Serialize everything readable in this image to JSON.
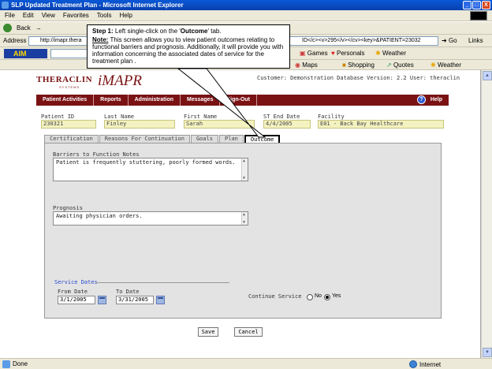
{
  "window": {
    "title": "SLP Updated Treatment Plan - Microsoft Internet Explorer",
    "controls": [
      "_",
      "□",
      "X"
    ]
  },
  "menu": [
    "File",
    "Edit",
    "View",
    "Favorites",
    "Tools",
    "Help"
  ],
  "toolbar": {
    "back_label": "Back",
    "address_label": "Address",
    "address_value": "http://imapr.thera",
    "address_tail": "ID</c><v>295</v></cv><key>&PATIENT=23032",
    "go_label": "Go",
    "links_label": "Links"
  },
  "aimbar": {
    "aim_label": "AIM",
    "games": "Games",
    "personals": "Personals",
    "weather": "Weather"
  },
  "linksbar": {
    "maps": "Maps",
    "shopping": "Shopping",
    "quotes": "Quotes",
    "weather": "Weather"
  },
  "app": {
    "brand": "THERACLIN",
    "brand_sub": "SYSTEMS",
    "product": "iMAPR",
    "customer_line": "Customer: Demonstration Database Version: 2.2 User: theraclin"
  },
  "nav": [
    "Patient Activities",
    "Reports",
    "Administration",
    "Messages",
    "Sign-Out"
  ],
  "help_label": "Help",
  "patient": {
    "fields": [
      {
        "label": "Patient ID",
        "value": "230321"
      },
      {
        "label": "Last Name",
        "value": "Finley"
      },
      {
        "label": "First Name",
        "value": "Sarah"
      },
      {
        "label": "ST End Date",
        "value": "4/4/2005"
      },
      {
        "label": "Facility",
        "value": "E01 - Back Bay Healthcare"
      }
    ]
  },
  "tabs": [
    "Certification",
    "Reasons For Continuation",
    "Goals",
    "Plan",
    "Outcome"
  ],
  "active_tab": "Outcome",
  "outcome": {
    "barriers_label": "Barriers to Function Notes",
    "barriers_value": "Patient is frequently stuttering, poorly formed words.",
    "prognosis_label": "Prognosis",
    "prognosis_value": "Awaiting physician orders.",
    "service_dates_label": "Service Dates",
    "from_label": "From Date",
    "from_value": "3/1/2005",
    "to_label": "To Date",
    "to_value": "3/31/2005",
    "continue_label": "Continue Service",
    "no_label": "No",
    "yes_label": "Yes",
    "continue_selected": "Yes"
  },
  "buttons": {
    "save": "Save",
    "cancel": "Cancel"
  },
  "status": {
    "text": "Done",
    "zone": "Internet"
  },
  "callout": {
    "step_prefix": "Step 1:",
    "step_text_a": " Left single-click on the '",
    "step_target": "Outcome",
    "step_text_b": "' tab.",
    "note_prefix": "Note:",
    "note_text": " This screen allows you to view patient outcomes relating to functional barriers and prognosis. Additionally, it will provide you with information concerning the associated dates of service for the treatment plan ."
  }
}
